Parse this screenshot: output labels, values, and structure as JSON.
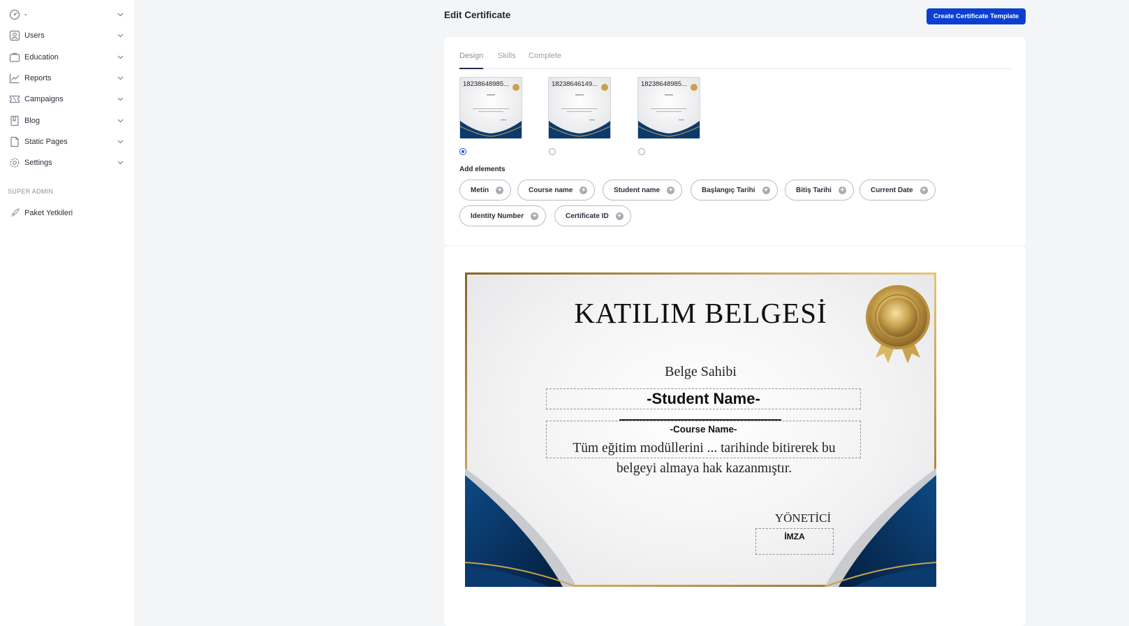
{
  "sidebar": {
    "items": [
      {
        "label": "-",
        "icon": "dashboard-icon"
      },
      {
        "label": "Users",
        "icon": "users-icon"
      },
      {
        "label": "Education",
        "icon": "briefcase-icon"
      },
      {
        "label": "Reports",
        "icon": "chart-line-icon"
      },
      {
        "label": "Campaigns",
        "icon": "ticket-icon"
      },
      {
        "label": "Blog",
        "icon": "bookmark-icon"
      },
      {
        "label": "Static Pages",
        "icon": "file-icon"
      },
      {
        "label": "Settings",
        "icon": "gear-icon"
      }
    ],
    "section_label": "SUPER ADMIN",
    "super_admin_item": {
      "label": "Paket Yetkileri",
      "icon": "rocket-icon"
    }
  },
  "header": {
    "title": "Edit Certificate",
    "create_button": "Create Certificate Template"
  },
  "tabs": [
    {
      "label": "Design",
      "active": true
    },
    {
      "label": "Skills",
      "active": false
    },
    {
      "label": "Complete",
      "active": false
    }
  ],
  "templates": [
    {
      "caption": "18238648985...",
      "selected": true
    },
    {
      "caption": "18238646149...",
      "selected": false
    },
    {
      "caption": "18238648985...",
      "selected": false
    }
  ],
  "add_elements": {
    "label": "Add elements",
    "chips": [
      "Metin",
      "Course name",
      "Student name",
      "Başlangıç Tarihi",
      "Bitiş Tarihi",
      "Current Date",
      "Identity Number",
      "Certificate ID"
    ]
  },
  "certificate": {
    "title": "KATILIM BELGESİ",
    "holder_label": "Belge Sahibi",
    "student_name": "-Student Name-",
    "course_name": "-Course Name-",
    "body_line1": "Tüm eğitim modüllerini  ... tarihinde bitirerek bu",
    "body_line2": "belgeyi almaya hak kazanmıştır.",
    "signer": "YÖNETİCİ",
    "signature": "İMZA"
  },
  "colors": {
    "primary_button": "#0a3fd1",
    "certificate_navy": "#0b3a6e",
    "certificate_gold": "#b8913f"
  }
}
